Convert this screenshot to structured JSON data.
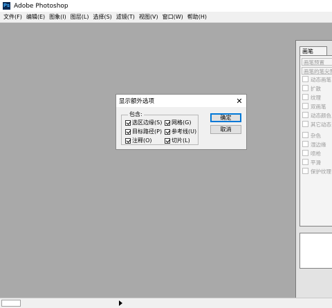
{
  "app": {
    "title": "Adobe Photoshop",
    "icon": "photoshop-app-icon"
  },
  "menu": [
    {
      "label": "文件(F)"
    },
    {
      "label": "编辑(E)"
    },
    {
      "label": "图象(I)"
    },
    {
      "label": "图层(L)"
    },
    {
      "label": "选择(S)"
    },
    {
      "label": "滤镜(T)"
    },
    {
      "label": "视图(V)"
    },
    {
      "label": "窗口(W)"
    },
    {
      "label": "帮助(H)"
    }
  ],
  "palette": {
    "tab": "画笔",
    "rows": [
      {
        "label": "画笔预置"
      },
      {
        "label": "画笔的笔尖形"
      },
      {
        "label": "动态画笔"
      },
      {
        "label": "扩散"
      },
      {
        "label": "纹理"
      },
      {
        "label": "双画笔"
      },
      {
        "label": "动态颜色"
      },
      {
        "label": "其它动态"
      },
      {
        "label": "杂色"
      },
      {
        "label": "湿边缘"
      },
      {
        "label": "喷枪"
      },
      {
        "label": "平滑"
      },
      {
        "label": "保护纹理"
      }
    ]
  },
  "dialog": {
    "title": "显示额外选项",
    "close": "✕",
    "group_label": "包含:",
    "options": [
      {
        "label": "选区边缘(S)",
        "checked": true
      },
      {
        "label": "网格(G)",
        "checked": true
      },
      {
        "label": "目标路径(P)",
        "checked": true
      },
      {
        "label": "参考线(U)",
        "checked": true
      },
      {
        "label": "注释(O)",
        "checked": true
      },
      {
        "label": "切片(L)",
        "checked": true
      }
    ],
    "ok": "确定",
    "cancel": "取消"
  },
  "colors": {
    "workspace": "#a9a9a9",
    "accent": "#0078d7"
  }
}
